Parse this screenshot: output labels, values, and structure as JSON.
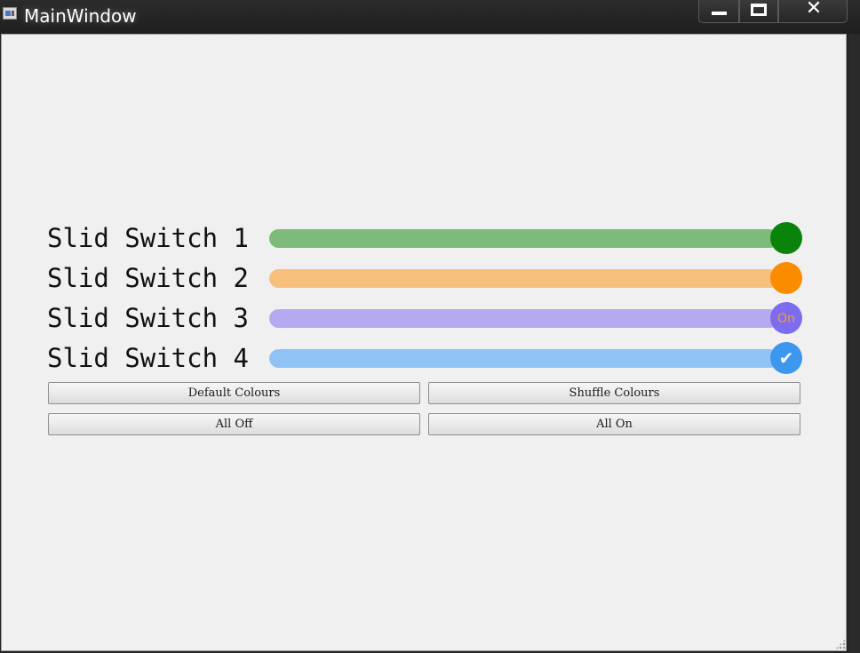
{
  "window": {
    "title": "MainWindow"
  },
  "switches": [
    {
      "label": "Slid Switch 1",
      "state": "on",
      "track_color": "#7cbb7a",
      "knob_color": "#0a830a",
      "knob_text": ""
    },
    {
      "label": "Slid Switch 2",
      "state": "on",
      "track_color": "#f6bf7b",
      "knob_color": "#fb8c00",
      "knob_text": ""
    },
    {
      "label": "Slid Switch 3",
      "state": "on",
      "track_color": "#b6a9ef",
      "knob_color": "#7d6bf0",
      "knob_text": "On"
    },
    {
      "label": "Slid Switch 4",
      "state": "on",
      "track_color": "#90c3f5",
      "knob_color": "#3d97ee",
      "knob_text": "✔"
    }
  ],
  "buttons": {
    "default_colours": "Default Colours",
    "shuffle_colours": "Shuffle Colours",
    "all_off": "All Off",
    "all_on": "All On"
  },
  "icons": {
    "app": "app-window-icon",
    "minimize": "minimize-icon",
    "maximize": "maximize-icon",
    "close": "close-icon"
  }
}
